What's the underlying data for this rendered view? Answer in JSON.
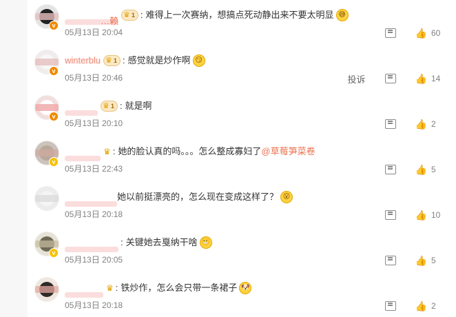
{
  "comments": [
    {
      "username": "…赖",
      "level": "1",
      "text": "难得上一次赛纳，想搞点死动静出来不要太明显",
      "emoji": "😅",
      "time": "05月13日 20:04",
      "likes": "60",
      "report": ""
    },
    {
      "username": "winterblu",
      "level": "1",
      "text": "感觉就是炒作啊",
      "emoji": "😏",
      "time": "05月13日 20:46",
      "likes": "14",
      "report": "投诉"
    },
    {
      "username": "",
      "level": "1",
      "text": "就是啊",
      "emoji": "",
      "time": "05月13日 20:10",
      "likes": "2",
      "report": ""
    },
    {
      "username": "",
      "level": "",
      "text": "她的脸认真的吗。。。怎么整成寡妇了",
      "mention": "@草莓笋菜卷",
      "emoji": "",
      "time": "05月13日 22:43",
      "likes": "5",
      "report": ""
    },
    {
      "username": "",
      "level": "",
      "text": "她以前挺漂亮的，怎么现在变成这样了？",
      "emoji": "😮",
      "time": "05月13日 20:18",
      "likes": "10",
      "report": ""
    },
    {
      "username": "",
      "level": "",
      "text": "关键她去戛纳干啥",
      "emoji": "😬",
      "time": "05月13日 20:05",
      "likes": "5",
      "report": ""
    },
    {
      "username": "",
      "level": "",
      "text": "铁炒作，怎么会只带一条裙子",
      "emoji": "🐶",
      "time": "05月13日 20:18",
      "likes": "2",
      "report": ""
    }
  ],
  "icons": {
    "verified": "v-badge-icon",
    "crown": "crown-icon",
    "comment": "comment-icon",
    "like": "thumb-up-icon"
  },
  "colors": {
    "username": "#eb7350",
    "text": "#333333",
    "meta": "#808080",
    "verified_orange": "#f08a00",
    "verified_yellow": "#f6c100"
  }
}
